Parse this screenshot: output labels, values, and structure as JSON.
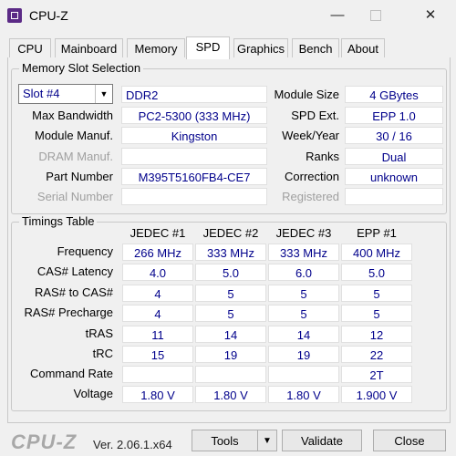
{
  "window": {
    "title": "CPU-Z"
  },
  "tabs": [
    "CPU",
    "Mainboard",
    "Memory",
    "SPD",
    "Graphics",
    "Bench",
    "About"
  ],
  "active_tab": "SPD",
  "slot_section": {
    "title": "Memory Slot Selection",
    "selected_slot": "Slot #4",
    "memory_type": "DDR2",
    "module_size_label": "Module Size",
    "module_size": "4 GBytes",
    "max_bandwidth_label": "Max Bandwidth",
    "max_bandwidth": "PC2-5300 (333 MHz)",
    "spd_ext_label": "SPD Ext.",
    "spd_ext": "EPP 1.0",
    "module_manuf_label": "Module Manuf.",
    "module_manuf": "Kingston",
    "week_year_label": "Week/Year",
    "week_year": "30 / 16",
    "dram_manuf_label": "DRAM Manuf.",
    "dram_manuf": "",
    "ranks_label": "Ranks",
    "ranks": "Dual",
    "part_number_label": "Part Number",
    "part_number": "M395T5160FB4-CE7",
    "correction_label": "Correction",
    "correction": "unknown",
    "serial_number_label": "Serial Number",
    "serial_number": "",
    "registered_label": "Registered",
    "registered": ""
  },
  "timings": {
    "title": "Timings Table",
    "columns": [
      "JEDEC #1",
      "JEDEC #2",
      "JEDEC #3",
      "EPP #1"
    ],
    "rows": [
      {
        "label": "Frequency",
        "values": [
          "266 MHz",
          "333 MHz",
          "333 MHz",
          "400 MHz"
        ]
      },
      {
        "label": "CAS# Latency",
        "values": [
          "4.0",
          "5.0",
          "6.0",
          "5.0"
        ]
      },
      {
        "label": "RAS# to CAS#",
        "values": [
          "4",
          "5",
          "5",
          "5"
        ]
      },
      {
        "label": "RAS# Precharge",
        "values": [
          "4",
          "5",
          "5",
          "5"
        ]
      },
      {
        "label": "tRAS",
        "values": [
          "11",
          "14",
          "14",
          "12"
        ]
      },
      {
        "label": "tRC",
        "values": [
          "15",
          "19",
          "19",
          "22"
        ]
      },
      {
        "label": "Command Rate",
        "values": [
          "",
          "",
          "",
          "2T"
        ]
      },
      {
        "label": "Voltage",
        "values": [
          "1.80 V",
          "1.80 V",
          "1.80 V",
          "1.900 V"
        ]
      }
    ]
  },
  "footer": {
    "brand": "CPU-Z",
    "version": "Ver. 2.06.1.x64",
    "tools_label": "Tools",
    "validate_label": "Validate",
    "close_label": "Close"
  },
  "icons": {
    "app": "cpu-z-app-icon",
    "minimize": "minimize-icon",
    "maximize": "maximize-icon",
    "close": "close-icon",
    "dropdown": "chevron-down-icon"
  }
}
